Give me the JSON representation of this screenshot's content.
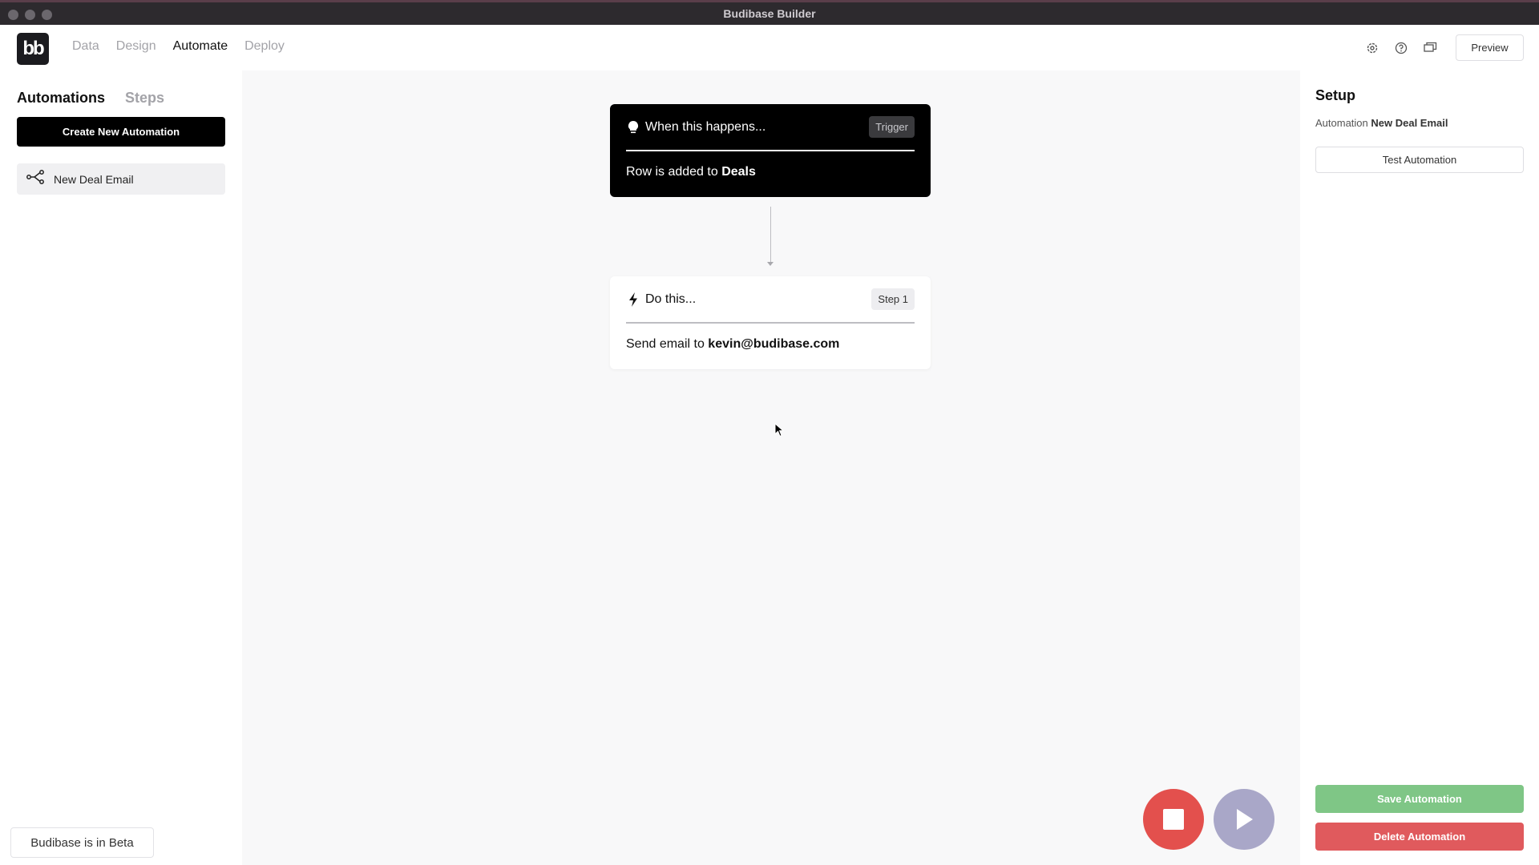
{
  "window": {
    "title": "Budibase Builder"
  },
  "topnav": {
    "logo_text": "bb",
    "tabs": [
      {
        "label": "Data",
        "active": false
      },
      {
        "label": "Design",
        "active": false
      },
      {
        "label": "Automate",
        "active": true
      },
      {
        "label": "Deploy",
        "active": false
      }
    ],
    "icons": [
      "settings-icon",
      "help-icon",
      "feedback-icon"
    ],
    "preview_label": "Preview"
  },
  "sidebar": {
    "tabs": [
      {
        "label": "Automations",
        "active": true
      },
      {
        "label": "Steps",
        "active": false
      }
    ],
    "create_label": "Create New Automation",
    "automations": [
      {
        "label": "New Deal Email",
        "icon": "flow-icon"
      }
    ],
    "beta_label": "Budibase is in Beta"
  },
  "canvas": {
    "trigger": {
      "title": "When this happens...",
      "tag": "Trigger",
      "body_prefix": "Row is added to",
      "body_bold": "Deals",
      "icon": "lightbulb-icon"
    },
    "action": {
      "title": "Do this...",
      "tag": "Step 1",
      "body_prefix": "Send email to",
      "body_bold": "kevin@budibase.com",
      "icon": "lightning-icon"
    }
  },
  "setup": {
    "title": "Setup",
    "automation_label": "Automation",
    "automation_name": "New Deal Email",
    "test_label": "Test Automation",
    "save_label": "Save Automation",
    "delete_label": "Delete Automation"
  },
  "colors": {
    "save": "#7fc686",
    "delete": "#e05a5d",
    "stop": "#e3504d",
    "play": "#a9a7c8"
  }
}
